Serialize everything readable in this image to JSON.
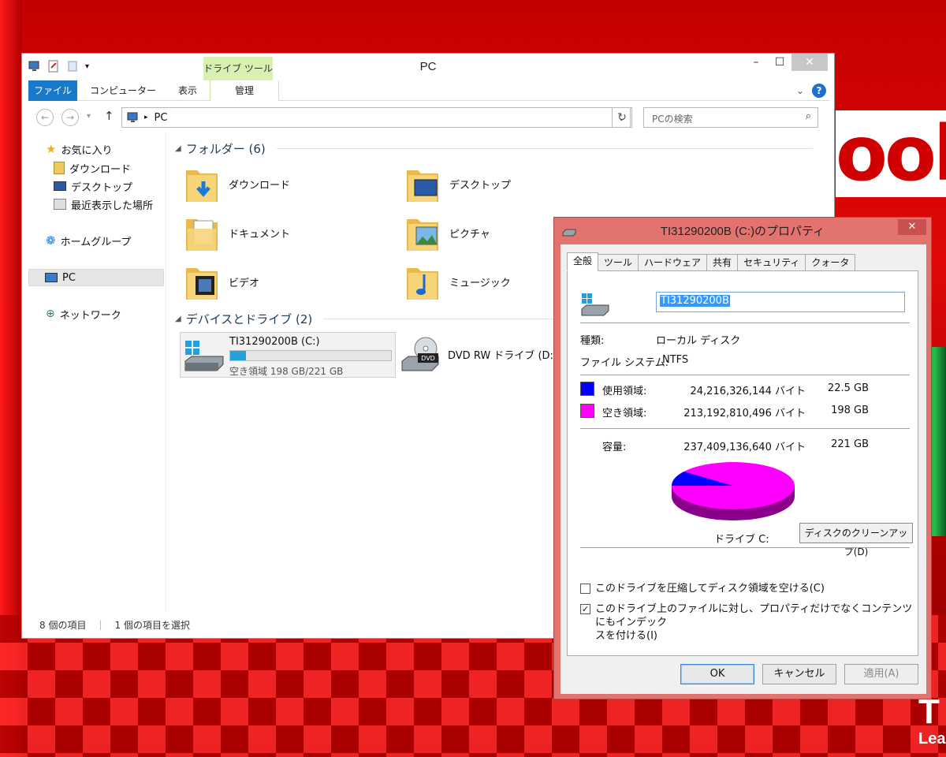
{
  "explorer": {
    "title": "PC",
    "context_tab_group": "ドライブ ツール",
    "ribbon_tabs": {
      "file": "ファイル",
      "computer": "コンピューター",
      "view": "表示",
      "manage": "管理"
    },
    "address": {
      "path": "PC"
    },
    "search": {
      "placeholder": "PCの検索"
    },
    "nav": {
      "favorites": "お気に入り",
      "downloads": "ダウンロード",
      "desktop": "デスクトップ",
      "recent": "最近表示した場所",
      "homegroup": "ホームグループ",
      "pc": "PC",
      "network": "ネットワーク"
    },
    "groups": {
      "folders": "フォルダー (6)",
      "devices": "デバイスとドライブ (2)"
    },
    "folders": [
      "ダウンロード",
      "デスクトップ",
      "ドキュメント",
      "ピクチャ",
      "ビデオ",
      "ミュージック"
    ],
    "drive_c": {
      "name": "TI31290200B (C:)",
      "free_text": "空き領域 198 GB/221 GB",
      "used_fraction": 0.1
    },
    "drive_d": {
      "name": "DVD RW ドライブ (D:)",
      "badge": "DVD"
    },
    "status": {
      "items": "8 個の項目",
      "selected": "1 個の項目を選択"
    }
  },
  "dialog": {
    "title": "TI31290200B (C:)のプロパティ",
    "tabs": [
      "全般",
      "ツール",
      "ハードウェア",
      "共有",
      "セキュリティ",
      "クォータ"
    ],
    "name_value": "TI31290200B",
    "type_label": "種類:",
    "type_value": "ローカル ディスク",
    "fs_label": "ファイル システム:",
    "fs_value": "NTFS",
    "used": {
      "label": "使用領域:",
      "bytes": "24,216,326,144 バイト",
      "size": "22.5 GB",
      "color": "#0000ff"
    },
    "free": {
      "label": "空き領域:",
      "bytes": "213,192,810,496 バイト",
      "size": "198 GB",
      "color": "#ff00ff"
    },
    "capacity": {
      "label": "容量:",
      "bytes": "237,409,136,640 バイト",
      "size": "221 GB"
    },
    "drive_label": "ドライブ C:",
    "cleanup_button": "ディスクのクリーンアップ(D)",
    "compress_option": {
      "label": "このドライブを圧縮してディスク領域を空ける(C)",
      "checked": false
    },
    "index_option": {
      "label_line1": "このドライブ上のファイルに対し、プロパティだけでなくコンテンツにもインデック",
      "label_line2": "スを付ける(I)",
      "checked": true
    },
    "buttons": {
      "ok": "OK",
      "cancel": "キャンセル",
      "apply": "適用(A)"
    }
  },
  "desktop": {
    "logo_text": "ool",
    "corner_big": "T",
    "corner_small": "Lea"
  }
}
